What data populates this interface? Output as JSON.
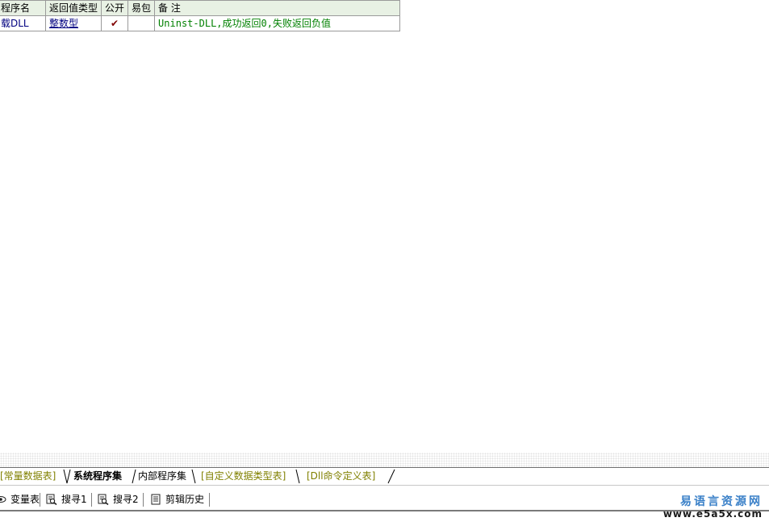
{
  "table": {
    "headers": {
      "name": "程序名",
      "return_type": "返回值类型",
      "public": "公开",
      "easy_pack": "易包",
      "note": "备 注"
    },
    "rows": [
      {
        "name": "载DLL",
        "return_type": "整数型",
        "public": "✔",
        "easy_pack": "",
        "note": "Uninst-DLL,成功返回0,失败返回负值"
      }
    ]
  },
  "tabs": {
    "constants": "[常量数据表]",
    "system_programs": "系统程序集",
    "internal_programs": "内部程序集",
    "custom_types": "[自定义数据类型表]",
    "dll_commands": "[Dll命令定义表]"
  },
  "toolbar": {
    "variables": "变量表",
    "search1": "搜寻1",
    "search2": "搜寻2",
    "clip_history": "剪辑历史"
  },
  "watermark": {
    "title": "易语言资源网",
    "url": "www.e5a5x.com"
  },
  "colors": {
    "header_bg": "#e8f1e4",
    "note_green": "#008000",
    "link_navy": "#000080",
    "inactive_tab": "#808000",
    "watermark_blue": "#3a80c8"
  },
  "icons": {
    "variables": "eye-icon",
    "search1": "magnifier-icon",
    "search2": "magnifier-icon",
    "clip_history": "clipboard-icon"
  }
}
